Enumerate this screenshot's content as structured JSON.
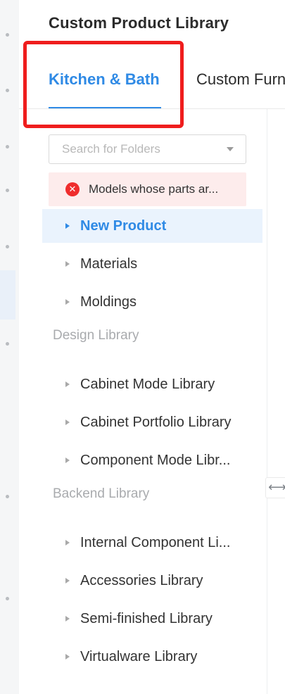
{
  "panel": {
    "title": "Custom Product Library"
  },
  "tabs": [
    {
      "label": "Kitchen & Bath",
      "active": true
    },
    {
      "label": "Custom Furniture",
      "active": false
    }
  ],
  "search": {
    "placeholder": "Search for Folders"
  },
  "alert": {
    "message": "Models whose parts ar...",
    "icon": "error-circle-icon"
  },
  "tree": {
    "top_items": [
      {
        "label": "New Product",
        "selected": true
      },
      {
        "label": "Materials"
      },
      {
        "label": "Moldings"
      }
    ],
    "design_library": {
      "heading": "Design Library",
      "items": [
        {
          "label": "Cabinet Mode Library"
        },
        {
          "label": "Cabinet Portfolio Library"
        },
        {
          "label": "Component Mode Libr..."
        }
      ]
    },
    "backend_library": {
      "heading": "Backend Library",
      "items": [
        {
          "label": "Internal Component Li..."
        },
        {
          "label": "Accessories Library"
        },
        {
          "label": "Semi-finished Library"
        },
        {
          "label": "Virtualware Library"
        }
      ]
    }
  },
  "resize_handle": {
    "icon": "resize-horizontal-icon",
    "glyph": "⟷"
  },
  "colors": {
    "accent": "#2f8ae5",
    "error": "#ef2d2d",
    "annotation": "#ef1d1d"
  }
}
